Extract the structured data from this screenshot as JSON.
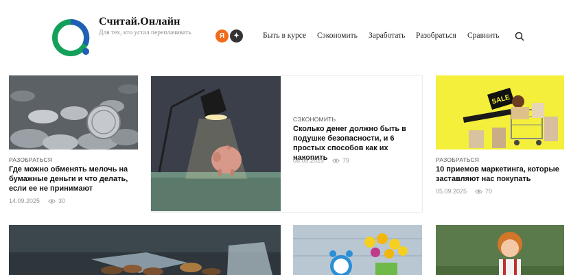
{
  "header": {
    "site_title": "Считай.Онлайн",
    "tagline": "Для тех, кто устал переплачивать",
    "social": {
      "yandex_letter": "Я",
      "zen_glyph": "✦"
    },
    "nav": [
      "Быть в курсе",
      "Сэкономить",
      "Заработать",
      "Разобраться",
      "Сравнить"
    ]
  },
  "colors": {
    "logo_green": "#13a05a",
    "logo_blue": "#1f5fb5",
    "yandex": "#f26b1d",
    "zen": "#333333"
  },
  "cards": [
    {
      "category": "РАЗОБРАТЬСЯ",
      "title": "Где можно обменять мелочь на бумажные деньги и что делать, если ее не принимают",
      "date": "14.09.2025",
      "views": "30"
    },
    {
      "category": "СЭКОНОМИТЬ",
      "title": "Сколько денег должно быть в подушке безопасности, и 6 простых способов как их накопить",
      "date": "08.09.2025",
      "views": "79"
    },
    {
      "category": "РАЗОБРАТЬСЯ",
      "title": "10 приемов маркетинга, которые заставляют нас покупать",
      "date": "05.09.2025",
      "views": "70",
      "sign": "SALE"
    }
  ]
}
